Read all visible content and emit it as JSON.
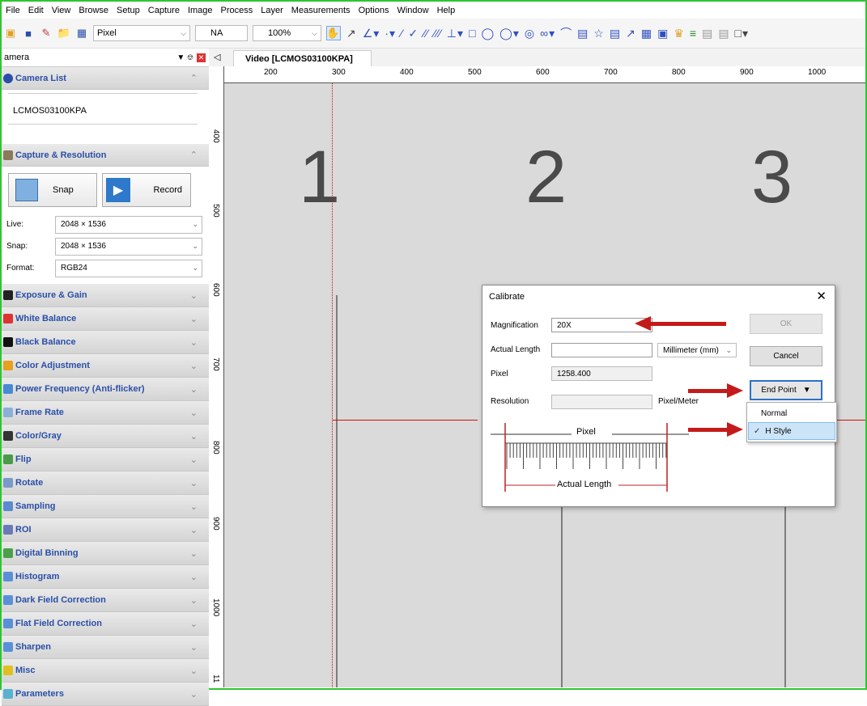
{
  "menu": [
    "File",
    "Edit",
    "View",
    "Browse",
    "Setup",
    "Capture",
    "Image",
    "Process",
    "Layer",
    "Measurements",
    "Options",
    "Window",
    "Help"
  ],
  "toolbar": {
    "unit": "Pixel",
    "mag": "NA",
    "zoom": "100%"
  },
  "panel": {
    "title": "amera",
    "camera_list": {
      "title": "Camera List",
      "device": "LCMOS03100KPA"
    },
    "capture": {
      "title": "Capture & Resolution",
      "snap": "Snap",
      "record": "Record",
      "live_label": "Live:",
      "live_value": "2048 × 1536",
      "snap_label": "Snap:",
      "snap_value": "2048 × 1536",
      "format_label": "Format:",
      "format_value": "RGB24"
    },
    "sections": [
      {
        "label": "Exposure & Gain",
        "color": "#222"
      },
      {
        "label": "White Balance",
        "color": "#d33"
      },
      {
        "label": "Black Balance",
        "color": "#111"
      },
      {
        "label": "Color Adjustment",
        "color": "#e8a020"
      },
      {
        "label": "Power Frequency (Anti-flicker)",
        "color": "#4a8ad4"
      },
      {
        "label": "Frame Rate",
        "color": "#8ab0d8"
      },
      {
        "label": "Color/Gray",
        "color": "#333"
      },
      {
        "label": "Flip",
        "color": "#4a9a4a"
      },
      {
        "label": "Rotate",
        "color": "#7a9ac8"
      },
      {
        "label": "Sampling",
        "color": "#5a8ad0"
      },
      {
        "label": "ROI",
        "color": "#6a7ab8"
      },
      {
        "label": "Digital Binning",
        "color": "#4aa04a"
      },
      {
        "label": "Histogram",
        "color": "#5a90d8"
      },
      {
        "label": "Dark Field Correction",
        "color": "#5a90d8"
      },
      {
        "label": "Flat Field Correction",
        "color": "#5a90d8"
      },
      {
        "label": "Sharpen",
        "color": "#5a90d8"
      },
      {
        "label": "Misc",
        "color": "#e0c020"
      },
      {
        "label": "Parameters",
        "color": "#5ab0d0"
      }
    ]
  },
  "document": {
    "tab": "Video [LCMOS03100KPA]"
  },
  "ruler_top": [
    "200",
    "300",
    "400",
    "500",
    "600",
    "700",
    "800",
    "900",
    "1000"
  ],
  "ruler_left": [
    "400",
    "500",
    "600",
    "700",
    "800",
    "900",
    "1000",
    "11"
  ],
  "image_numbers": [
    "1",
    "2",
    "3"
  ],
  "dialog": {
    "title": "Calibrate",
    "magnification_label": "Magnification",
    "magnification_value": "20X",
    "actual_length_label": "Actual Length",
    "actual_length_value": "",
    "unit_value": "Millimeter (mm)",
    "pixel_label": "Pixel",
    "pixel_value": "1258.400",
    "resolution_label": "Resolution",
    "resolution_value": "",
    "resolution_unit": "Pixel/Meter",
    "ok": "OK",
    "cancel": "Cancel",
    "endpoint": "End Point",
    "diagram_pixel": "Pixel",
    "diagram_actual": "Actual Length",
    "menu_items": [
      {
        "label": "Normal",
        "checked": false
      },
      {
        "label": "H Style",
        "checked": true
      }
    ]
  },
  "colors": {
    "frame": "#2fc52f",
    "arrow": "#c41a1a",
    "sectionText": "#2a4fa8"
  }
}
